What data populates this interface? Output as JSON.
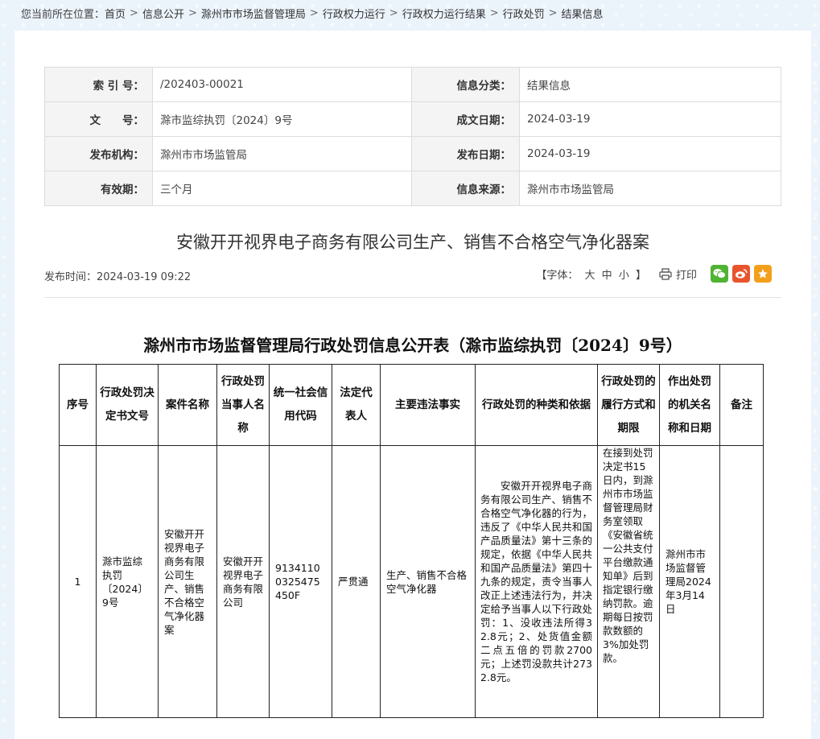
{
  "breadcrumb": {
    "prefix": "您当前所在位置：",
    "items": [
      "首页",
      "信息公开",
      "滁州市市场监督管理局",
      "行政权力运行",
      "行政权力运行结果",
      "行政处罚",
      "结果信息"
    ]
  },
  "meta": {
    "rows": [
      {
        "k1": "索 引 号：",
        "v1": "/202403-00021",
        "k2": "信息分类：",
        "v2": "结果信息"
      },
      {
        "k1": "文　　号：",
        "v1": "滁市监综执罚〔2024〕9号",
        "k2": "成文日期：",
        "v2": "2024-03-19"
      },
      {
        "k1": "发布机构：",
        "v1": "滁州市市场监管局",
        "k2": "发布日期：",
        "v2": "2024-03-19"
      },
      {
        "k1": "有效期：",
        "v1": "三个月",
        "k2": "信息来源：",
        "v2": "滁州市市场监管局"
      }
    ]
  },
  "article": {
    "title": "安徽开开视界电子商务有限公司生产、销售不合格空气净化器案",
    "publish_time": "发布时间：2024-03-19 09:22",
    "font_label": "【字体：",
    "font_big": "大",
    "font_mid": "中",
    "font_small": "小",
    "font_end": "】",
    "print_label": "打印"
  },
  "icons": {
    "print": "printer-icon",
    "wechat": "wechat-icon",
    "weibo": "weibo-icon",
    "favorite": "star-icon"
  },
  "colors": {
    "wechat": "#51b333",
    "weibo": "#e8542c",
    "favorite": "#f2a01b"
  },
  "penalty": {
    "title": "滁州市市场监督管理局行政处罚信息公开表（滁市监综执罚〔2024〕9号）",
    "headers": [
      "序号",
      "行政处罚决定书文号",
      "案件名称",
      "行政处罚当事人名称",
      "统一社会信用代码",
      "法定代表人",
      "主要违法事实",
      "行政处罚的种类和依据",
      "行政处罚的履行方式和期限",
      "作出处罚的机关名称和日期",
      "备注"
    ],
    "rows": [
      {
        "seq": "1",
        "doc_no": "滁市监综执罚〔2024〕9号",
        "case_name": "安徽开开视界电子商务有限公司生产、销售不合格空气净化器案",
        "party": "安徽开开视界电子商务有限公司",
        "credit_code": "91341100325475450F",
        "legal_rep": "严贯通",
        "facts": "生产、销售不合格空气净化器",
        "basis": "安徽开开视界电子商务有限公司生产、销售不合格空气净化器的行为，违反了《中华人民共和国产品质量法》第十三条的规定，依据《中华人民共和国产品质量法》第四十九条的规定，责令当事人改正上述违法行为，并决定给予当事人以下行政处罚：1、没收违法所得32.8元；2、处货值金额二点五倍的罚款2700元；上述罚没款共计2732.8元。",
        "execution": "在接到处罚决定书15日内，到滁州市市场监督管理局财务室领取《安徽省统一公共支付平台缴款通知单》后到指定银行缴纳罚款。逾期每日按罚款数额的3%加处罚款。",
        "authority": "滁州市市场监督管理局2024年3月14日",
        "remark": ""
      }
    ]
  }
}
